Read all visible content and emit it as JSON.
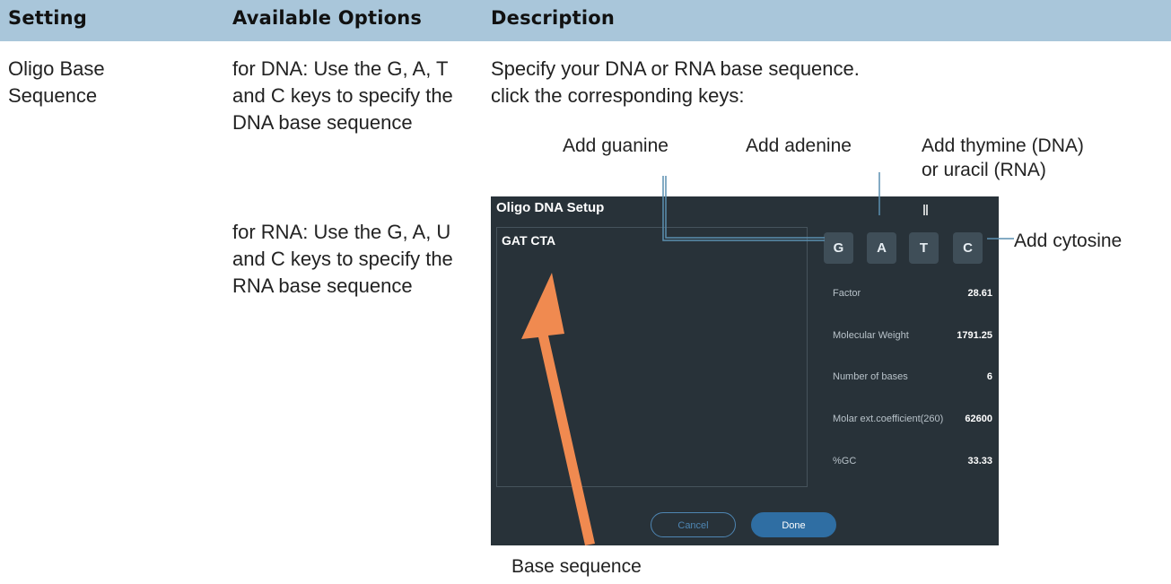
{
  "table": {
    "headers": [
      "Setting",
      "Available Options",
      "Description"
    ],
    "setting": "Oligo Base Sequence",
    "options_dna": "for DNA: Use the G, A, T and C keys to specify the DNA base sequence",
    "options_rna": "for RNA: Use the G, A, U and C keys to specify the RNA base sequence",
    "description_1": "Specify your DNA or RNA base sequence.",
    "description_2": "click the corresponding keys:"
  },
  "callouts": {
    "guanine": "Add guanine",
    "adenine": "Add adenine",
    "thymine_1": "Add thymine (DNA)",
    "thymine_2": "or uracil (RNA)",
    "cytosine": "Add cytosine",
    "base_sequence": "Base sequence"
  },
  "screen": {
    "title": "Oligo DNA Setup",
    "sequence": "GAT CTA",
    "keys": [
      "G",
      "A",
      "T",
      "C"
    ],
    "info": [
      {
        "label": "Factor",
        "value": "28.61"
      },
      {
        "label": "Molecular Weight",
        "value": "1791.25"
      },
      {
        "label": "Number of bases",
        "value": "6"
      },
      {
        "label": "Molar ext.coefficient(260)",
        "value": "62600"
      },
      {
        "label": "%GC",
        "value": "33.33"
      }
    ],
    "cancel_label": "Cancel",
    "done_label": "Done"
  },
  "colors": {
    "header": "#a9c6da",
    "screen_bg": "#283239",
    "key_bg": "#3f4e58",
    "done_button": "#2f6ea3",
    "arrow": "#f08a50",
    "callout_line": "#5b8fb0"
  }
}
